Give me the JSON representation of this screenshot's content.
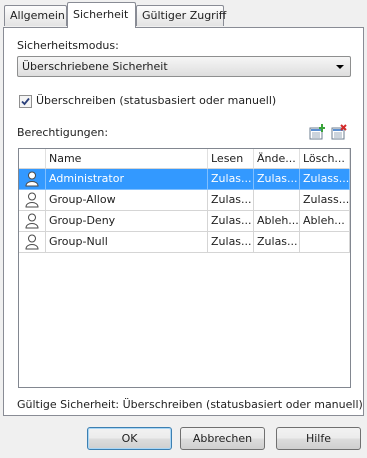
{
  "tabs": [
    "Allgemein",
    "Sicherheit",
    "Gültiger Zugriff"
  ],
  "active_tab": "Sicherheit",
  "security_mode": {
    "label": "Sicherheitsmodus:",
    "selected": "Überschriebene Sicherheit"
  },
  "override": {
    "label": "Überschreiben (statusbasiert oder manuell)",
    "checked": true
  },
  "permissions": {
    "label": "Berechtigungen:",
    "icons": [
      "add-entry-icon",
      "remove-entry-icon"
    ],
    "columns": [
      "Name",
      "Lesen",
      "Ände...",
      "Lösch..."
    ],
    "rows": [
      {
        "name": "Administrator",
        "read": "Zulas...",
        "change": "Zulas...",
        "delete": "Zulass..."
      },
      {
        "name": "Group-Allow",
        "read": "Zulas...",
        "change": "",
        "delete": "Zulass..."
      },
      {
        "name": "Group-Deny",
        "read": "Zulas...",
        "change": "Ableh...",
        "delete": "Ableh..."
      },
      {
        "name": "Group-Null",
        "read": "Zulas...",
        "change": "Zulas...",
        "delete": ""
      }
    ],
    "selected_row": 0
  },
  "effective_security": "Gültige Sicherheit: Überschreiben (statusbasiert oder manuell)",
  "buttons": {
    "ok": "OK",
    "cancel": "Abbrechen",
    "help": "Hilfe"
  },
  "colors": {
    "selection": "#3399ff",
    "panel_border": "#898c95",
    "dialog_bg": "#f0f0f0"
  }
}
